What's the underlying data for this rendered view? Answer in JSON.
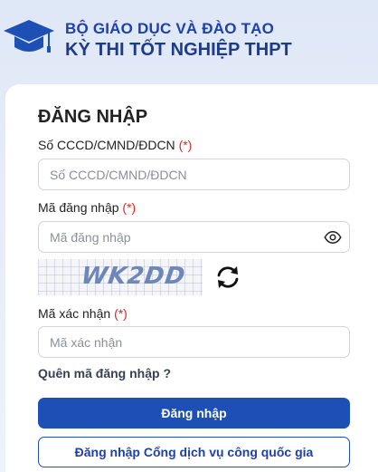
{
  "header": {
    "org_name": "BỘ GIÁO DỤC VÀ ĐÀO TẠO",
    "exam_name": "KỲ THI TỐT NGHIỆP THPT",
    "logo_icon": "graduation-cap-icon"
  },
  "login": {
    "title": "ĐĂNG NHẬP",
    "id_field": {
      "label": "Số CCCD/CMND/ĐDCN",
      "required_mark": "(*)",
      "placeholder": "Số CCCD/CMND/ĐDCN",
      "value": ""
    },
    "password_field": {
      "label": "Mã đăng nhập",
      "required_mark": "(*)",
      "placeholder": "Mã đăng nhập",
      "value": "",
      "toggle_icon": "eye-icon"
    },
    "captcha": {
      "text": "WK2DD",
      "refresh_icon": "refresh-icon"
    },
    "captcha_field": {
      "label": "Mã xác nhận",
      "required_mark": "(*)",
      "placeholder": "Mã xác nhận",
      "value": ""
    },
    "forgot_link": "Quên mã đăng nhập ?",
    "submit_label": "Đăng nhập",
    "national_portal_label": "Đăng nhập Cổng dịch vụ công quốc gia"
  },
  "colors": {
    "primary": "#1e4fb5",
    "heading_blue": "#1e3a8a",
    "required": "#dc2626"
  }
}
